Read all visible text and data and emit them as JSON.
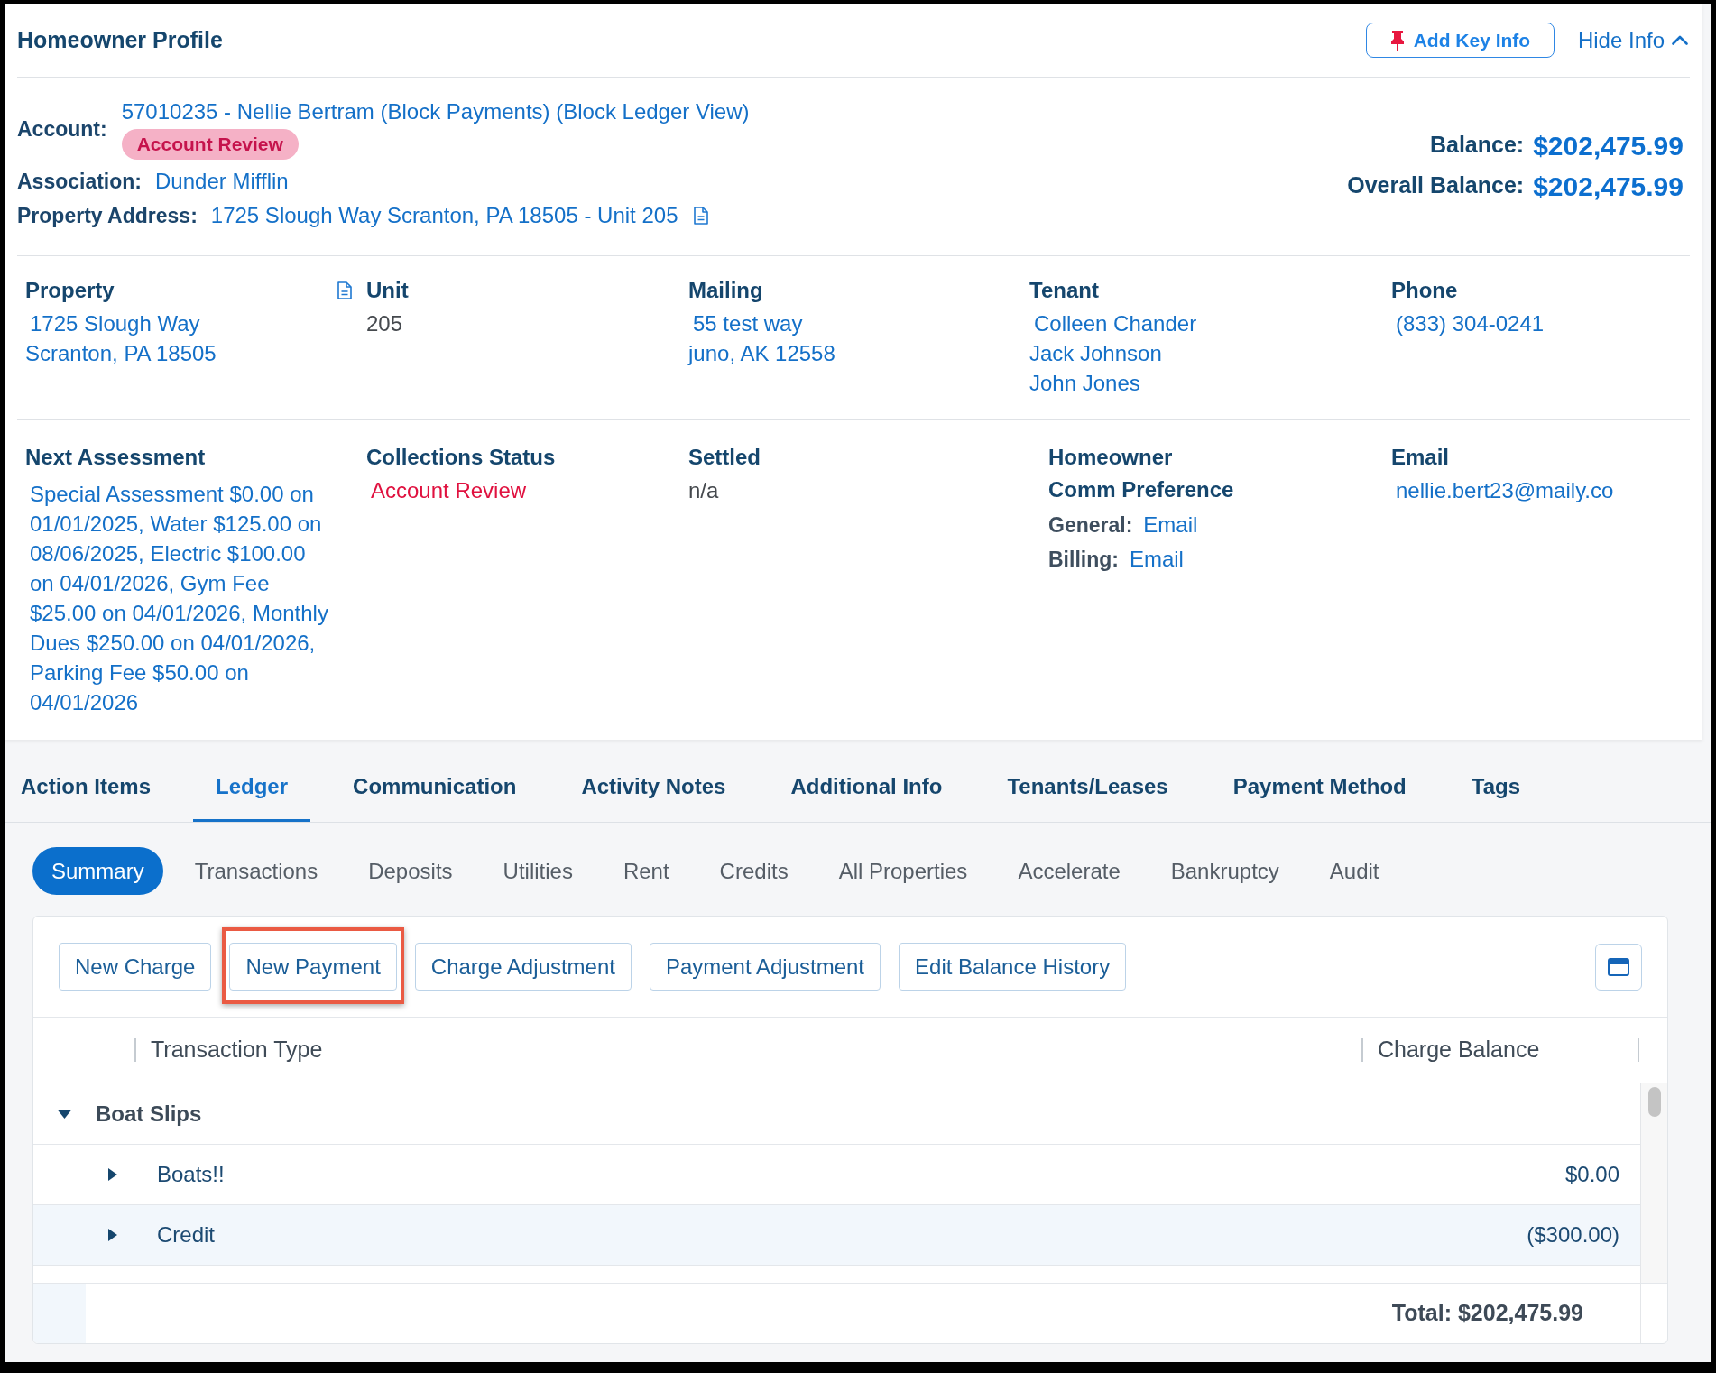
{
  "header": {
    "title": "Homeowner Profile",
    "add_key_info_button": "Add Key Info",
    "hide_info_button": "Hide Info"
  },
  "summary": {
    "account": {
      "label": "Account:",
      "value": "57010235 - Nellie Bertram (Block Payments) (Block Ledger View)",
      "badge": "Account Review"
    },
    "fields": [
      {
        "kind": "link",
        "label": "Association:",
        "value": "Dunder Mifflin"
      },
      {
        "kind": "address",
        "label": "Property Address:",
        "value": "1725 Slough Way Scranton, PA 18505 - Unit 205"
      }
    ],
    "balances": [
      {
        "label": "Balance:",
        "value": "$202,475.99"
      },
      {
        "label": "Overall Balance:",
        "value": "$202,475.99"
      }
    ]
  },
  "detail_rows": [
    [
      {
        "kind": "address",
        "heading": "Property",
        "lines": [
          "1725 Slough Way",
          "Scranton, PA 18505"
        ]
      },
      {
        "kind": "text",
        "heading": "Unit",
        "lines": [
          "205"
        ]
      },
      {
        "kind": "link",
        "heading": "Mailing",
        "lines": [
          "55 test way",
          "juno, AK 12558"
        ]
      },
      {
        "kind": "link",
        "heading": "Tenant",
        "lines": [
          "Colleen Chander",
          "Jack Johnson",
          "John Jones"
        ]
      },
      {
        "kind": "link",
        "heading": "Phone",
        "lines": [
          "(833) 304-0241"
        ]
      }
    ],
    [
      {
        "kind": "paragraph",
        "heading": "Next Assessment",
        "text": "Special Assessment $0.00 on 01/01/2025, Water $125.00 on 08/06/2025, Electric $100.00 on 04/01/2026, Gym Fee $25.00 on 04/01/2026, Monthly Dues $250.00 on 04/01/2026, Parking Fee $50.00 on 04/01/2026"
      },
      {
        "kind": "status",
        "heading": "Collections Status",
        "lines": [
          "Account Review"
        ]
      },
      {
        "kind": "text",
        "heading": "Settled",
        "lines": [
          "n/a"
        ]
      },
      {
        "kind": "preference",
        "heading": "Homeowner",
        "subheading": "Comm Preference",
        "items": [
          {
            "label": "General:",
            "value": "Email"
          },
          {
            "label": "Billing:",
            "value": "Email"
          }
        ]
      },
      {
        "kind": "link",
        "heading": "Email",
        "lines": [
          "nellie.bert23@maily.co"
        ]
      }
    ]
  ],
  "tabs": [
    {
      "label": "Action Items",
      "selected": false
    },
    {
      "label": "Ledger",
      "selected": true
    },
    {
      "label": "Communication",
      "selected": false
    },
    {
      "label": "Activity Notes",
      "selected": false
    },
    {
      "label": "Additional Info",
      "selected": false
    },
    {
      "label": "Tenants/Leases",
      "selected": false
    },
    {
      "label": "Payment Method",
      "selected": false
    },
    {
      "label": "Tags",
      "selected": false
    }
  ],
  "subtabs": [
    {
      "label": "Summary",
      "selected": true
    },
    {
      "label": "Transactions",
      "selected": false
    },
    {
      "label": "Deposits",
      "selected": false
    },
    {
      "label": "Utilities",
      "selected": false
    },
    {
      "label": "Rent",
      "selected": false
    },
    {
      "label": "Credits",
      "selected": false
    },
    {
      "label": "All Properties",
      "selected": false
    },
    {
      "label": "Accelerate",
      "selected": false
    },
    {
      "label": "Bankruptcy",
      "selected": false
    },
    {
      "label": "Audit",
      "selected": false
    }
  ],
  "toolbar": {
    "buttons": [
      {
        "label": "New Charge",
        "highlighted": false
      },
      {
        "label": "New Payment",
        "highlighted": true
      },
      {
        "label": "Charge Adjustment",
        "highlighted": false
      },
      {
        "label": "Payment Adjustment",
        "highlighted": false
      },
      {
        "label": "Edit Balance History",
        "highlighted": false
      }
    ]
  },
  "table": {
    "columns": [
      {
        "label": "Transaction Type"
      },
      {
        "label": "Charge Balance"
      }
    ],
    "groups": [
      {
        "label": "Boat Slips",
        "expanded": true,
        "rows": [
          {
            "label": "Boats!!",
            "balance": "$0.00",
            "expanded": false
          },
          {
            "label": "Credit",
            "balance": "($300.00)",
            "expanded": false
          }
        ]
      }
    ],
    "footer": {
      "total": "Total: $202,475.99"
    }
  }
}
